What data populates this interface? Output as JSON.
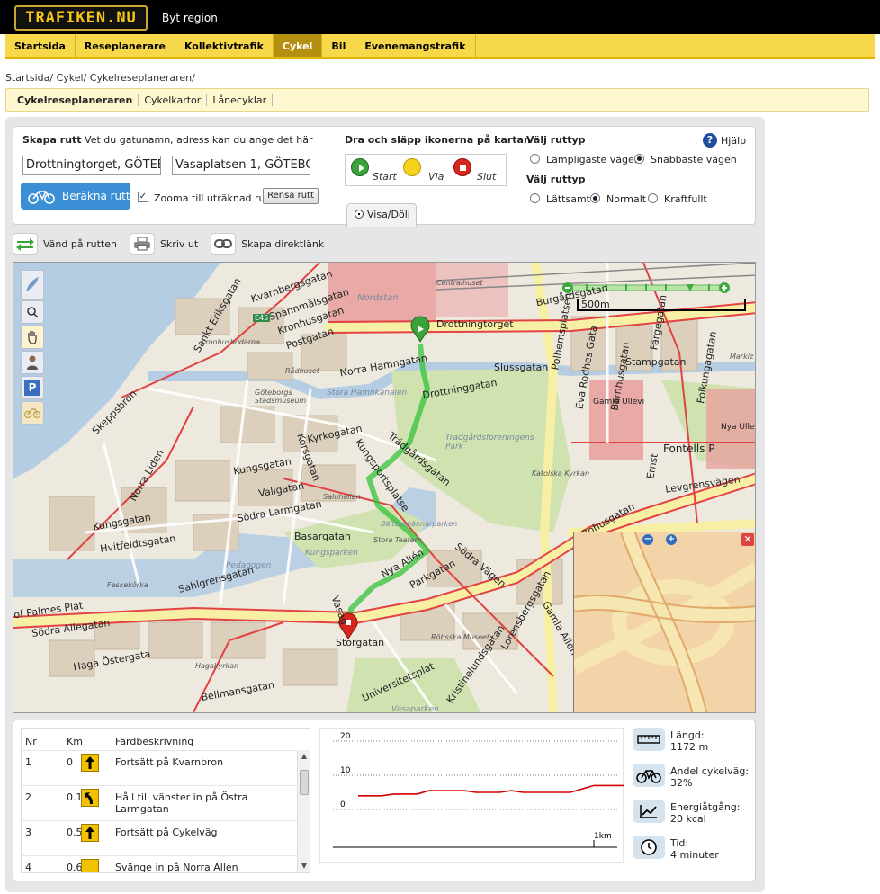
{
  "header": {
    "logo": "TRAFIKEN.NU",
    "region": "Byt region"
  },
  "mainnav": [
    "Startsida",
    "Reseplanerare",
    "Kollektivtrafik",
    "Cykel",
    "Bil",
    "Evenemangstrafik"
  ],
  "breadcrumb": "Startsida/  Cykel/  Cykelreseplaneraren/",
  "subnav": [
    "Cykelreseplaneraren",
    "Cykelkartor",
    "Lånecyklar"
  ],
  "route": {
    "title_bold": "Skapa rutt",
    "title_rest": " Vet du gatunamn, adress kan du ange det här",
    "from": "Drottningtorget, GÖTEBO",
    "to": "Vasaplatsen 1, GÖTEBOR",
    "calc_label": "Beräkna rutt",
    "zoom_label": "Zooma till uträknad rutt",
    "zoom_checked": "✓",
    "clear_label": "Rensa rutt",
    "drag_title": "Dra och släpp ikonerna på kartan",
    "start": "Start",
    "via": "Via",
    "end": "Slut",
    "routetype_title1": "Välj ruttyp",
    "routetype_opts1": [
      "Lämpligaste vägen",
      "Snabbaste vägen"
    ],
    "routetype_title2": "Välj ruttyp",
    "routetype_opts2": [
      "Lättsamt",
      "Normalt",
      "Kraftfullt"
    ],
    "help": "Hjälp",
    "show_hide": "Visa/Dölj"
  },
  "toolbar": [
    "Vänd på rutten",
    "Skriv ut",
    "Skapa direktlänk"
  ],
  "map": {
    "scale": "500m",
    "streets": {
      "kvarnbergsgatan": "Kvarnbergsgatan",
      "spannmalsgatan": "Spannmålsgatan",
      "kronhusgatan": "Kronhusgatan",
      "postgatan": "Postgatan",
      "drottningtorget": "Drottningtorget",
      "sanktEriksgatan": "Sankt Eriksgatan",
      "norraHamngatan": "Norra Hamngatan",
      "slussgatan": "Slussgatan",
      "drottninggatan": "Drottninggatan",
      "stampgatan": "Stampgatan",
      "kyrkogatan": "Kyrkogatan",
      "korsgatan": "Korsgatan",
      "kungsgatan": "Kungsgatan",
      "vallgatan": "Vallgatan",
      "sodraLarmgatan": "Södra Larmgatan",
      "basargatan": "Basargatan",
      "traedgardsgatan": "Trädgårdsgatan",
      "kungsportsplatsen": "Kungsportsplatse",
      "skeppsbron": "Skeppsbron",
      "stadsLiden": "Norra Liden",
      "kungsgatan2": "Kungsgatan",
      "hvitfeldtsgatan": "Hvitfeldtsgatan",
      "nyaAllen": "Nya Allén",
      "parkgatan": "Parkgatan",
      "sodraVagen": "Södra Vägen",
      "storgatan": "Storgatan",
      "sahlgrensgatan": "Sahlgrensgatan",
      "levgrensvagen": "Levgrensvägen",
      "bohusgatan": "Bohusgatan",
      "fontells": "Fontells P",
      "gamlaAllen": "Gamla Allén",
      "nyaUllevi": "Nya Ullevi",
      "gamlaUllevi": "Gamla Ullevi",
      "nordstan": "Nordstan",
      "centralhuset": "Centralhuset",
      "stora": "Stora Hamnkanalen",
      "vasagatan": "Vasag",
      "universitetsplatsen": "Universitetsplat",
      "kristinelund": "Kristinelundsgatan",
      "lorensberg": "Lorensbergsgatan",
      "haga": "Haga Östergata",
      "bellmansgatan": "Bellmansgatan",
      "kungsparken": "Kungsparken",
      "pedagogen": "Pedagogen",
      "traedgardsforeningen": "Trädgårdsföreningens Park",
      "e45": "E45",
      "burgardsgatan": "Burgårdsgatan",
      "bar": "Barnhusgatan",
      "falkengatan": "Folkungagatan",
      "faregatan": "Färgegatan",
      "evaRodhes": "Eva Rodhes Gata",
      "polhemsplatsen": "Polhemsplatsen",
      "ernst": "Ernst",
      "sodraAllegatan": "Södra Allegatan",
      "palmes": "of Palmes Plat",
      "kronhusbodarna": "Kronhusbodarna",
      "radhuset": "Rådhuset",
      "stadsmuseum": "Göteborgs Stadsmuseum",
      "saluhallen": "Saluhallen",
      "storaTeatern": "Stora Teatern",
      "baltesspannar": "Bältesspännarparken",
      "hagakyrkan": "Hagakyrkan",
      "feskekorka": "Feskekôrka",
      "katolska": "Katolska Kyrkan",
      "rohsska": "Röhsska Museet",
      "vasaparken": "Vasaparken",
      "mariakyrkan": "Markiz",
      "ostraLarm": "Burgårdsgat"
    }
  },
  "directions": {
    "headers": [
      "Nr",
      "Km",
      "Färdbeskrivning"
    ],
    "rows": [
      {
        "nr": "1",
        "km": "0",
        "text": "Fortsätt på Kvarnbron",
        "dir": "straight"
      },
      {
        "nr": "2",
        "km": "0.1",
        "text": "Håll till vänster in på Östra Larmgatan",
        "dir": "left"
      },
      {
        "nr": "3",
        "km": "0.5",
        "text": "Fortsätt på Cykelväg",
        "dir": "straight"
      },
      {
        "nr": "4",
        "km": "0.6",
        "text": "Svänge in på Norra Allén",
        "dir": "straight"
      }
    ]
  },
  "chart_data": {
    "type": "line",
    "ylim": [
      0,
      20
    ],
    "yticks": [
      0,
      10,
      20
    ],
    "xtick_label": "1km",
    "x": [
      0,
      0.05,
      0.1,
      0.15,
      0.2,
      0.25,
      0.3,
      0.35,
      0.4,
      0.45,
      0.5,
      0.55,
      0.6,
      0.65,
      0.7,
      0.75,
      0.8,
      0.85,
      0.9,
      0.95,
      1.0,
      1.05,
      1.1,
      1.15
    ],
    "series": [
      {
        "values": [
          4,
          4,
          4,
          4.5,
          4.5,
          4.5,
          5.5,
          5.5,
          5.5,
          5.5,
          5,
          5,
          5,
          5.5,
          5,
          5,
          5,
          5,
          5,
          6,
          7,
          7,
          7,
          7
        ]
      }
    ],
    "color": "#d40000"
  },
  "stats": [
    {
      "label": "Längd:",
      "value": "1172 m",
      "icon": "ruler-icon"
    },
    {
      "label": "Andel cykelväg:",
      "value": "32%",
      "icon": "bicycle-icon"
    },
    {
      "label": "Energiåtgång:",
      "value": "20 kcal",
      "icon": "chart-line-icon"
    },
    {
      "label": "Tid:",
      "value": "4 minuter",
      "icon": "clock-icon"
    }
  ]
}
